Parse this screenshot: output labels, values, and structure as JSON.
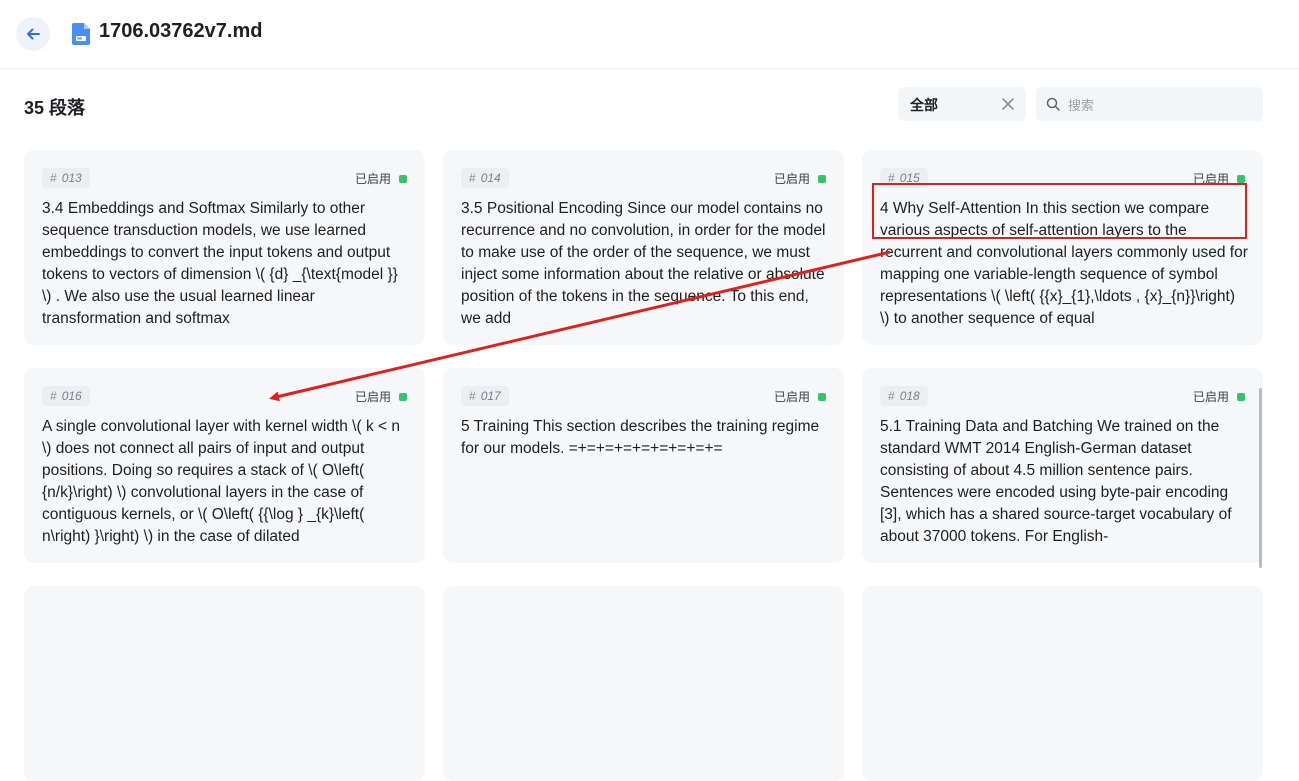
{
  "header": {
    "back_icon": "arrow-left-icon",
    "file_icon": "markdown-file-icon",
    "title": "1706.03762v7.md"
  },
  "toolbar": {
    "count_label": "35 段落",
    "filter_value": "全部",
    "filter_clear_icon": "close-icon",
    "search_icon": "search-icon",
    "search_placeholder": "搜索"
  },
  "status_color": "#34c46a",
  "annotation": {
    "color": "#e0201c"
  },
  "cards": [
    {
      "id": "013",
      "status": "已启用",
      "text": "3.4 Embeddings and Softmax Similarly to other sequence transduction models, we use learned embeddings to convert the input tokens and output tokens to vectors of dimension \\( {d} _{\\text{model }} \\) . We also use the usual learned linear transformation and softmax"
    },
    {
      "id": "014",
      "status": "已启用",
      "text": "3.5 Positional Encoding Since our model contains no recurrence and no convolution, in order for the model to make use of the order of the sequence, we must inject some information about the relative or absolute position of the tokens in the sequence. To this end, we add"
    },
    {
      "id": "015",
      "status": "已启用",
      "text": "4 Why Self-Attention In this section we compare various aspects of self-attention layers to the recurrent and convolutional layers commonly used for mapping one variable-length sequence of symbol representations \\( \\left( {{x}_{1},\\ldots , {x}_{n}}\\right) \\) to another sequence of equal"
    },
    {
      "id": "016",
      "status": "已启用",
      "text": "A single convolutional layer with kernel width \\( k < n \\) does not connect all pairs of input and output positions. Doing so requires a stack of \\( O\\left( {n/k}\\right) \\) convolutional layers in the case of contiguous kernels, or \\( O\\left( {{\\log } _{k}\\left( n\\right) }\\right) \\) in the case of dilated"
    },
    {
      "id": "017",
      "status": "已启用",
      "text": "5 Training This section describes the training regime for our models. =+=+=+=+=+=+=+=+="
    },
    {
      "id": "018",
      "status": "已启用",
      "text": "5.1 Training Data and Batching We trained on the standard WMT 2014 English-German dataset consisting of about 4.5 million sentence pairs. Sentences were encoded using byte-pair encoding [3], which has a shared source-target vocabulary of about 37000 tokens. For English-"
    }
  ]
}
